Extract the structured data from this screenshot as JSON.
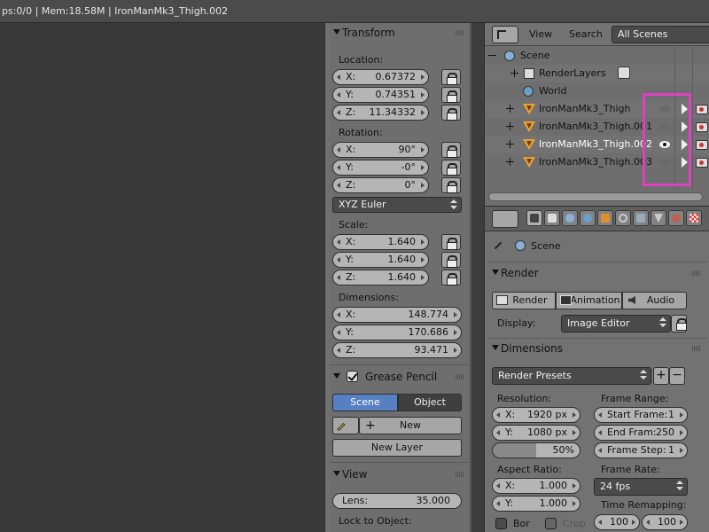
{
  "statusbar": {
    "text": "ps:0/0 | Mem:18.58M | IronManMk3_Thigh.002"
  },
  "transform": {
    "title": "Transform",
    "location_label": "Location:",
    "location": [
      {
        "axis": "X:",
        "value": "0.67372"
      },
      {
        "axis": "Y:",
        "value": "0.74351"
      },
      {
        "axis": "Z:",
        "value": "11.34332"
      }
    ],
    "rotation_label": "Rotation:",
    "rotation": [
      {
        "axis": "X:",
        "value": "90°"
      },
      {
        "axis": "Y:",
        "value": "-0°"
      },
      {
        "axis": "Z:",
        "value": "0°"
      }
    ],
    "rotation_mode": "XYZ Euler",
    "scale_label": "Scale:",
    "scale": [
      {
        "axis": "X:",
        "value": "1.640"
      },
      {
        "axis": "Y:",
        "value": "1.640"
      },
      {
        "axis": "Z:",
        "value": "1.640"
      }
    ],
    "dimensions_label": "Dimensions:",
    "dimensions": [
      {
        "axis": "X:",
        "value": "148.774"
      },
      {
        "axis": "Y:",
        "value": "170.686"
      },
      {
        "axis": "Z:",
        "value": "93.471"
      }
    ]
  },
  "grease_pencil": {
    "title": "Grease Pencil",
    "scene_label": "Scene",
    "object_label": "Object",
    "new_label": "New",
    "new_layer_label": "New Layer"
  },
  "view": {
    "title": "View",
    "lens_label": "Lens:",
    "lens_value": "35.000",
    "lock_label": "Lock to Object:"
  },
  "outliner": {
    "view_menu": "View",
    "search_menu": "Search",
    "scenes_dropdown": "All Scenes",
    "rows": [
      {
        "label": "Scene"
      },
      {
        "label": "RenderLayers"
      },
      {
        "label": "World"
      },
      {
        "label": "IronManMk3_Thigh"
      },
      {
        "label": "IronManMk3_Thigh.001"
      },
      {
        "label": "IronManMk3_Thigh.002"
      },
      {
        "label": "IronManMk3_Thigh.003"
      }
    ]
  },
  "properties": {
    "context_label": "Scene",
    "render": {
      "title": "Render",
      "render_btn": "Render",
      "animation_btn": "Animation",
      "audio_btn": "Audio",
      "display_label": "Display:",
      "display_value": "Image Editor"
    },
    "dimensions": {
      "title": "Dimensions",
      "presets": "Render Presets",
      "resolution_label": "Resolution:",
      "res_x_label": "X:",
      "res_x": "1920 px",
      "res_y_label": "Y:",
      "res_y": "1080 px",
      "res_pct": "50%",
      "frame_range_label": "Frame Range:",
      "start_label": "Start Frame:",
      "start": "1",
      "end_label": "End Fram:",
      "end": "250",
      "step_label": "Frame Step:",
      "step": "1",
      "aspect_label": "Aspect Ratio:",
      "asp_x_label": "X:",
      "asp_x": "1.000",
      "asp_y_label": "Y:",
      "asp_y": "1.000",
      "frame_rate_label": "Frame Rate:",
      "frame_rate": "24 fps",
      "time_remap_label": "Time Remapping:",
      "remap_old": "100",
      "remap_new": "100",
      "border_label": "Bor",
      "crop_label": "Crop"
    }
  },
  "colors": {
    "accent_blue": "#5680c2",
    "highlight_pink": "#e040c0",
    "object_orange": "#f0a030"
  }
}
